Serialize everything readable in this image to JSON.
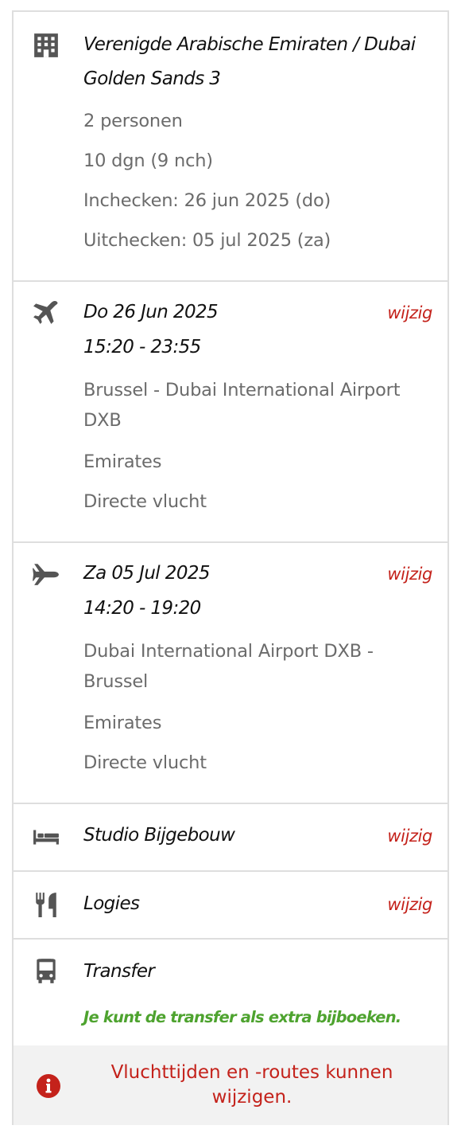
{
  "accommodation": {
    "destination": "Verenigde Arabische Emiraten / Dubai",
    "hotel": "Golden Sands 3",
    "persons": "2 personen",
    "duration": "10 dgn (9 nch)",
    "checkin": "Inchecken: 26 jun 2025 (do)",
    "checkout": "Uitchecken: 05 jul 2025 (za)"
  },
  "outbound_flight": {
    "date": "Do 26 Jun 2025",
    "times": "15:20 - 23:55",
    "route_line1": "Brussel - Dubai International Airport",
    "route_line2": "DXB",
    "airline": "Emirates",
    "type": "Directe vlucht",
    "edit_label": "wijzig"
  },
  "return_flight": {
    "date": "Za 05 Jul 2025",
    "times": "14:20 - 19:20",
    "route_line1": "Dubai International Airport DXB -",
    "route_line2": "Brussel",
    "airline": "Emirates",
    "type": "Directe vlucht",
    "edit_label": "wijzig"
  },
  "room": {
    "label": "Studio Bijgebouw",
    "edit_label": "wijzig"
  },
  "board": {
    "label": "Logies",
    "edit_label": "wijzig"
  },
  "transfer": {
    "label": "Transfer",
    "promo": "Je kunt de transfer als extra bijboeken."
  },
  "notice": {
    "line1": "Vluchttijden en -routes kunnen",
    "line2": "wijzigen."
  },
  "colors": {
    "accent_red": "#c4221b",
    "promo_green": "#4ea32f",
    "icon_gray": "#555555"
  }
}
